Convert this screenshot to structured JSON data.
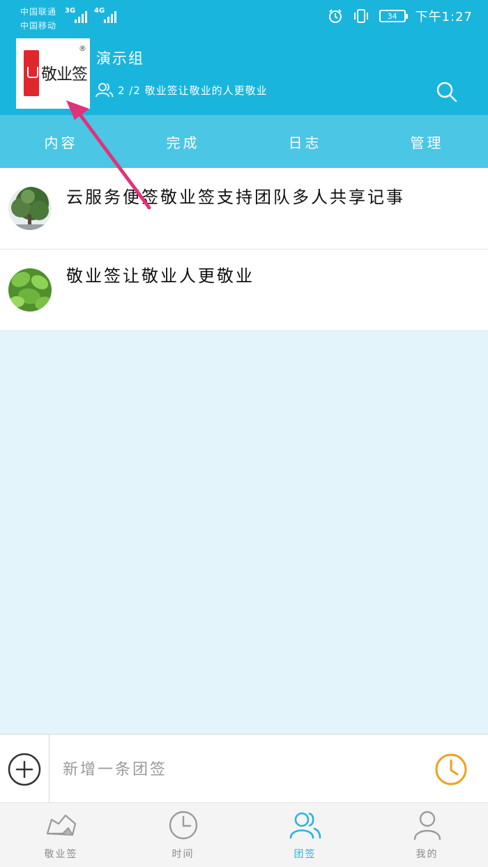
{
  "status_bar": {
    "carrier_1": "中国联通",
    "carrier_2": "中国移动",
    "network_1": "3G",
    "network_2": "4G",
    "battery": "34",
    "time": "下午1:27"
  },
  "header": {
    "logo_text": "敬业签",
    "logo_reg": "®",
    "group_name": "演示组",
    "member_info": "2 /2 敬业签让敬业的人更敬业",
    "icons": [
      "members-icon",
      "search-icon"
    ]
  },
  "tabs": [
    {
      "label": "内容"
    },
    {
      "label": "完成"
    },
    {
      "label": "日志"
    },
    {
      "label": "管理"
    }
  ],
  "notes": [
    {
      "text": "云服务便签敬业签支持团队多人共享记事",
      "avatar": "tree-photo"
    },
    {
      "text": "敬业签让敬业人更敬业",
      "avatar": "leaf-photo"
    }
  ],
  "composer": {
    "placeholder": "新增一条团签",
    "icons": [
      "add-icon",
      "clock-icon"
    ]
  },
  "bottom_nav": [
    {
      "label": "敬业签",
      "icon": "note-icon",
      "active": false
    },
    {
      "label": "时间",
      "icon": "clock-icon",
      "active": false
    },
    {
      "label": "团签",
      "icon": "team-icon",
      "active": true
    },
    {
      "label": "我的",
      "icon": "profile-icon",
      "active": false
    }
  ],
  "colors": {
    "header": "#1ab5dc",
    "tabs": "#4bc6e4",
    "background": "#e3f5fa",
    "accent": "#2bb3d8",
    "clock": "#f0a020",
    "annotation_arrow": "#e0337a"
  }
}
